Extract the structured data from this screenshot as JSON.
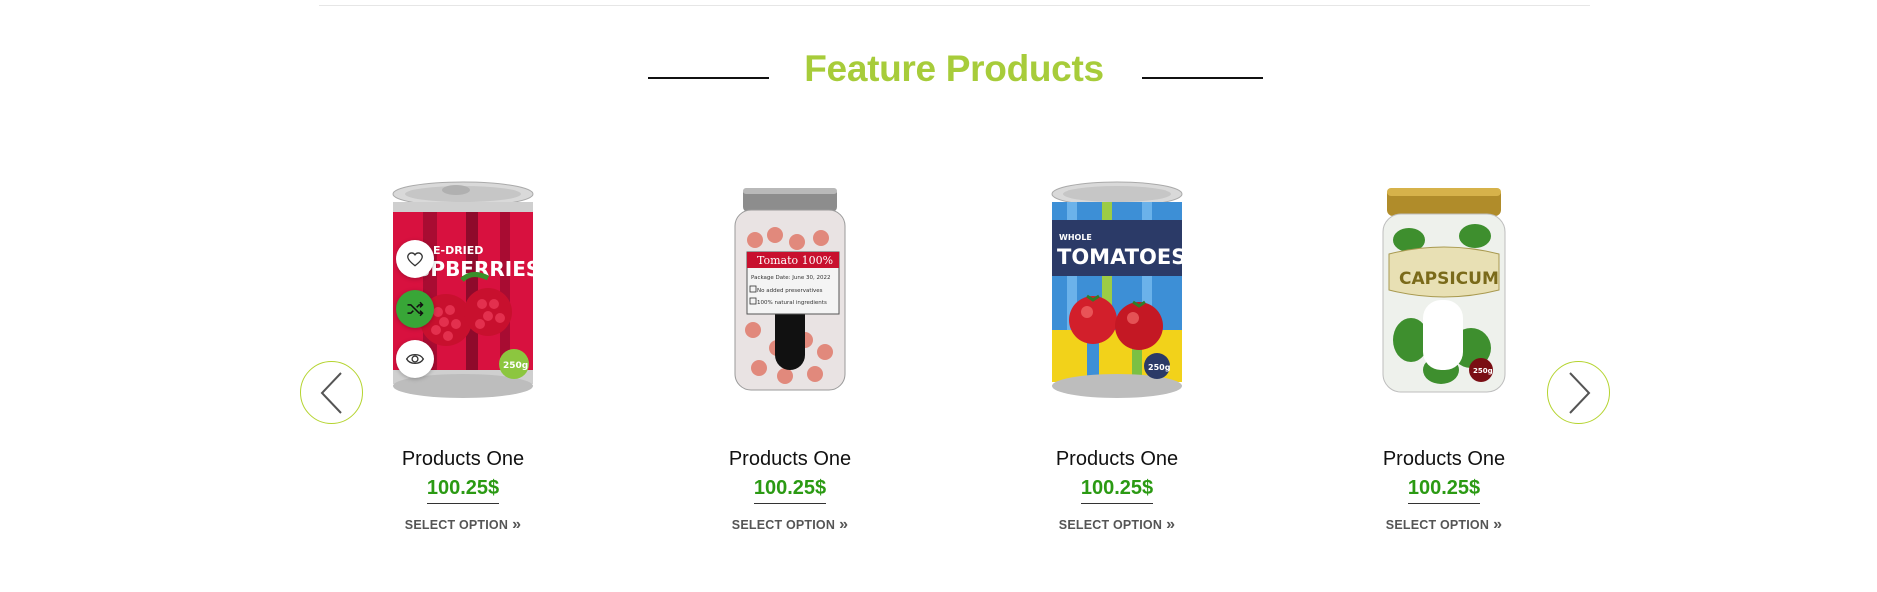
{
  "section": {
    "title": "Feature Products"
  },
  "colors": {
    "accent": "#a7cc3a",
    "price": "#2b9a13",
    "compare_active": "#38a637",
    "arrow_border": "#b5d430"
  },
  "navigation": {
    "prev_icon": "chevron-left-icon",
    "next_icon": "chevron-right-icon"
  },
  "products": [
    {
      "name": "Products One",
      "price": "100.25$",
      "option": "SELECT OPTION",
      "image": "raspberries-can",
      "label_lines": [
        "E-DRIED",
        "SPBERRIES"
      ],
      "weight": "250g"
    },
    {
      "name": "Products One",
      "price": "100.25$",
      "option": "SELECT OPTION",
      "image": "tomato-jar",
      "label_lines": [
        "Tomato 100%",
        "Package Date: June 30, 2022",
        "No added preservatives",
        "100% natural ingredients"
      ],
      "weight": ""
    },
    {
      "name": "Products One",
      "price": "100.25$",
      "option": "SELECT OPTION",
      "image": "tomatoes-can",
      "label_lines": [
        "WHOLE",
        "TOMATOES"
      ],
      "weight": "250g"
    },
    {
      "name": "Products One",
      "price": "100.25$",
      "option": "SELECT OPTION",
      "image": "capsicum-jar",
      "label_lines": [
        "CAPSICUM"
      ],
      "weight": "250g"
    }
  ],
  "hover_actions": {
    "wishlist": "heart-icon",
    "compare": "shuffle-icon",
    "quick_view": "eye-icon"
  }
}
